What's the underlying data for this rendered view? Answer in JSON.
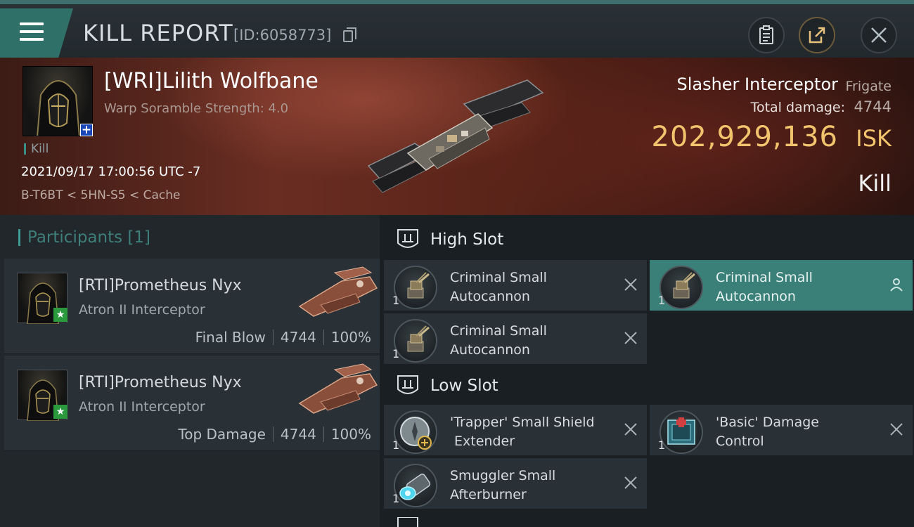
{
  "header": {
    "title": "KILL REPORT",
    "report_id": "[ID:6058773]"
  },
  "victim": {
    "name": "[WRI]Lilith Wolfbane",
    "warp_scramble": "Warp Soramble Strength: 4.0",
    "tag": "Kill",
    "timestamp": "2021/09/17 17:00:56 UTC -7",
    "location": "B-T6BT < 5HN-S5 < Cache",
    "ship_name": "Slasher Interceptor",
    "ship_class": "Frigate",
    "total_damage_label": "Total damage:",
    "total_damage": "4744",
    "isk_value": "202,929,136",
    "isk_unit": "ISK",
    "result": "Kill"
  },
  "participants": {
    "title": "Participants [1]",
    "items": [
      {
        "name": "[RTI]Prometheus Nyx",
        "ship": "Atron II Interceptor",
        "role": "Final Blow",
        "damage": "4744",
        "percent": "100%"
      },
      {
        "name": "[RTI]Prometheus Nyx",
        "ship": "Atron II Interceptor",
        "role": "Top Damage",
        "damage": "4744",
        "percent": "100%"
      }
    ]
  },
  "fitting": {
    "high_slot": {
      "label": "High Slot",
      "modules": [
        {
          "line1": "Criminal Small",
          "line2": "Autocannon",
          "qty": "1"
        },
        {
          "line1": "Criminal Small",
          "line2": "Autocannon",
          "qty": "1"
        },
        {
          "line1": "Criminal Small",
          "line2": "Autocannon",
          "qty": "1"
        }
      ]
    },
    "low_slot": {
      "label": "Low Slot",
      "modules": [
        {
          "line1": "'Trapper' Small Shield",
          "line2": " Extender",
          "qty": "1"
        },
        {
          "line1": "'Basic' Damage",
          "line2": "Control",
          "qty": "1"
        },
        {
          "line1": "Smuggler Small",
          "line2": "Afterburner",
          "qty": "1"
        }
      ]
    }
  },
  "colors": {
    "accent": "#3f9c92",
    "isk": "#f2c46e",
    "highlight": "#3a7f78"
  }
}
